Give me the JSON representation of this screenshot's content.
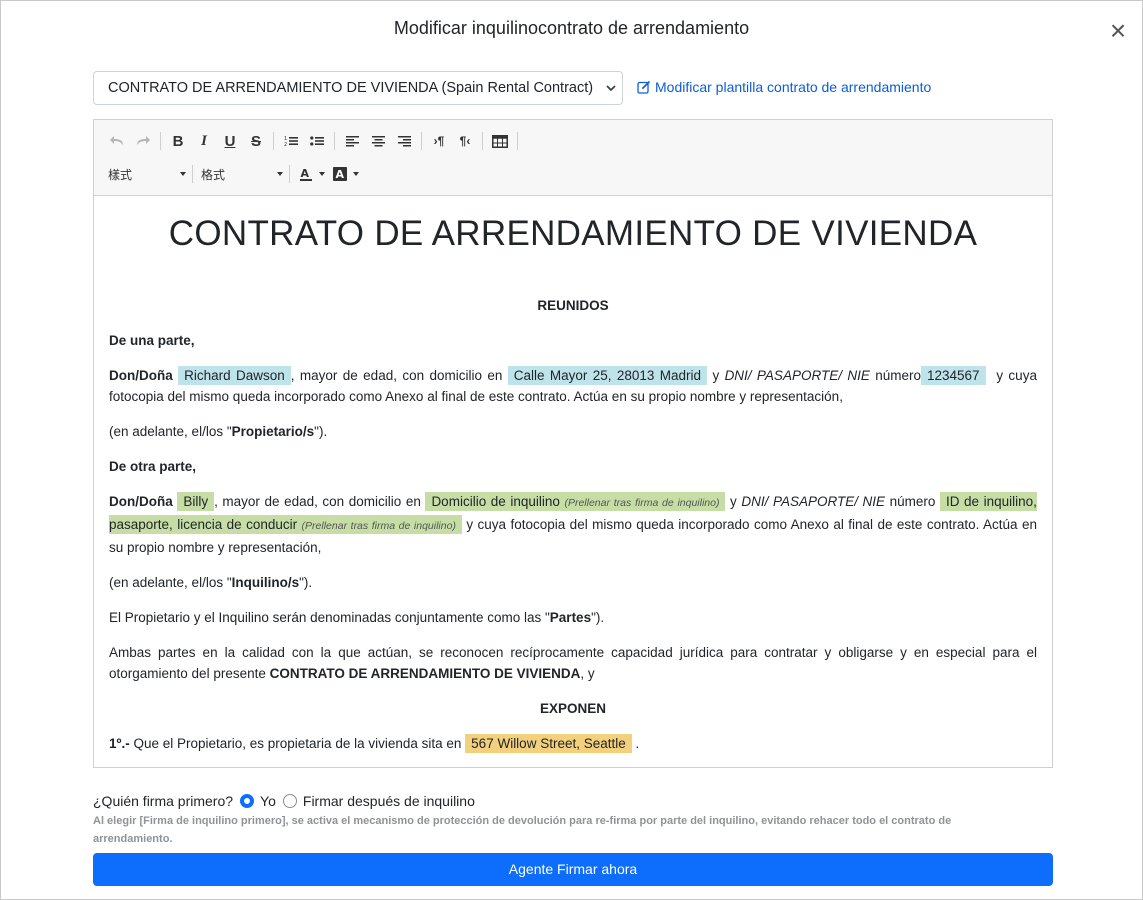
{
  "modal": {
    "title": "Modificar inquilinocontrato de arrendamiento",
    "close_symbol": "×"
  },
  "template": {
    "selected": "CONTRATO DE ARRENDAMIENTO DE VIVIENDA (Spain Rental Contract)",
    "edit_link": "Modificar plantilla contrato de arrendamiento"
  },
  "toolbar": {
    "style_label": "樣式",
    "format_label": "格式"
  },
  "document": {
    "title": "CONTRATO DE ARRENDAMIENTO DE VIVIENDA",
    "reunidos": "REUNIDOS",
    "de_una_parte": "De una parte,",
    "don_dona": "Don/Doña",
    "landlord_name": "Richard Dawson",
    "mayor_domicilio": ", mayor de edad, con domicilio en",
    "landlord_address": "Calle Mayor 25, 28013 Madrid",
    "y": "y",
    "dni_label": "DNI/ PASAPORTE/ NIE",
    "numero": "número",
    "landlord_id": "1234567",
    "landlord_tail": "y cuya fotocopia del mismo queda incorporado como Anexo al final de este contrato. Actúa en su propio nombre y representación,",
    "adelante_prefix": "(en adelante, el/los \"",
    "propietario": "Propietario/s",
    "adelante_suffix": "\").",
    "de_otra_parte": "De otra parte,",
    "tenant_name": "Billy",
    "tenant_address": "Domicilio de inquilino",
    "prefill_hint": "(Prellenar tras firma de inquilino)",
    "tenant_id": "ID de inquilino, pasaporte, licencia de conducir",
    "tenant_tail": "y cuya fotocopia del mismo queda incorporado como Anexo al final de este contrato. Actúa en su propio nombre y representación,",
    "inquilino": "Inquilino/s",
    "partes_prefix": "El Propietario y el Inquilino serán denominadas conjuntamente como las \"",
    "partes": "Partes",
    "ambas_text": "Ambas partes en la calidad con la que actúan, se reconocen recíprocamente capacidad jurídica para contratar y obligarse y en especial para el otorgamiento del presente",
    "contract_name": "CONTRATO DE ARRENDAMIENTO DE VIVIENDA",
    "ambas_tail": ", y",
    "exponen": "EXPONEN",
    "item1_label": "1º.-",
    "item1_text": "Que el Propietario, es propietaria de la vivienda sita en",
    "property_address": "567 Willow Street, Seattle",
    "period": "."
  },
  "signer": {
    "question": "¿Quién firma primero?",
    "option_me": "Yo",
    "option_after": "Firmar después de inquilino",
    "selected": "Yo",
    "help": "Al elegir [Firma de inquilino primero], se activa el mecanismo de protección de devolución para re-firma por parte del inquilino, evitando rehacer todo el contrato de arrendamiento."
  },
  "action": {
    "submit": "Agente Firmar ahora"
  },
  "colors": {
    "primary": "#0d6efd",
    "link": "#0b5ed7",
    "landlord_highlight": "#bfe3ea",
    "tenant_highlight": "#c6dea6",
    "property_highlight": "#f3d07b"
  },
  "icons": [
    "close-icon",
    "edit-icon",
    "undo-icon",
    "redo-icon",
    "bold-icon",
    "italic-icon",
    "underline-icon",
    "strikethrough-icon",
    "ordered-list-icon",
    "bullet-list-icon",
    "align-left-icon",
    "align-center-icon",
    "align-right-icon",
    "ltr-icon",
    "rtl-icon",
    "table-icon",
    "text-color-icon",
    "bg-color-icon"
  ]
}
